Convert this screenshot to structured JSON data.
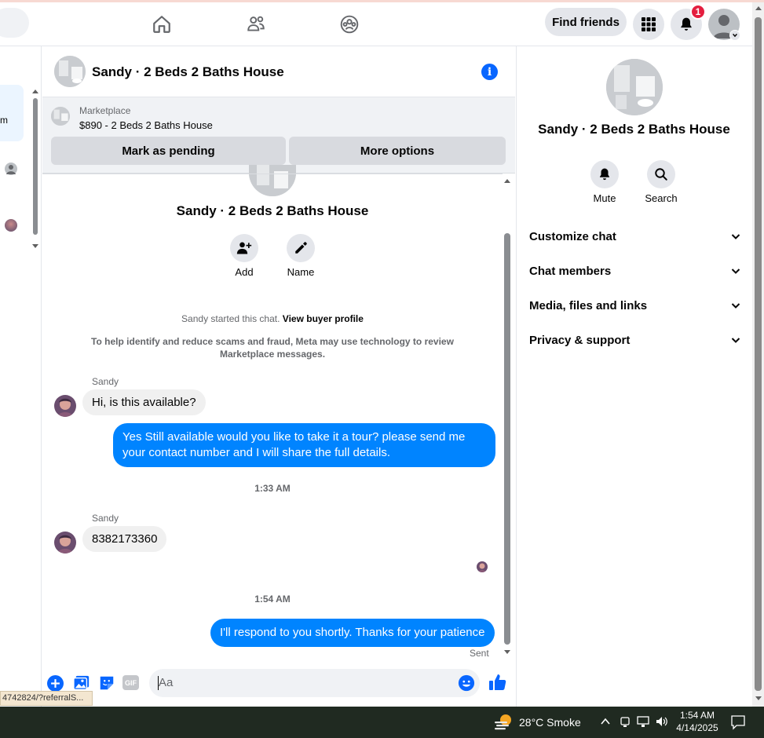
{
  "topbar": {
    "find_friends_label": "Find friends",
    "notification_count": "1"
  },
  "left_panel": {
    "selected_item_fragment": "m"
  },
  "chat_header": {
    "title": "Sandy · 2 Beds 2 Baths House"
  },
  "marketplace": {
    "label": "Marketplace",
    "listing": "$890 - 2 Beds 2 Baths House",
    "mark_pending_label": "Mark as pending",
    "more_options_label": "More options"
  },
  "chat_intro": {
    "title": "Sandy · 2 Beds 2 Baths House",
    "add_label": "Add",
    "name_label": "Name",
    "started_text": "Sandy started this chat.",
    "view_profile_link": "View buyer profile",
    "scam_notice": "To help identify and reduce scams and fraud, Meta may use technology to review Marketplace messages."
  },
  "messages": [
    {
      "type": "in",
      "sender": "Sandy",
      "text": "Hi, is this available?"
    },
    {
      "type": "out",
      "text": "Yes Still available would you like to take it a tour? please send me your contact number and I will share the full details."
    },
    {
      "type": "time",
      "text": "1:33 AM"
    },
    {
      "type": "in",
      "sender": "Sandy",
      "text": "8382173360"
    },
    {
      "type": "time",
      "text": "1:54 AM"
    },
    {
      "type": "out",
      "text": "I'll respond to you shortly. Thanks for your patience",
      "status": "Sent"
    }
  ],
  "composer": {
    "placeholder": "Aa"
  },
  "status_bar_url": "4742824/?referralS...",
  "right_panel": {
    "title": "Sandy · 2 Beds 2 Baths House",
    "mute_label": "Mute",
    "search_label": "Search",
    "sections": [
      "Customize chat",
      "Chat members",
      "Media, files and links",
      "Privacy & support"
    ]
  },
  "taskbar": {
    "weather": "28°C  Smoke",
    "time": "1:54 AM",
    "date": "4/14/2025"
  },
  "colors": {
    "accent_blue": "#0084ff",
    "icon_blue": "#0866ff",
    "badge_red": "#e41e3f",
    "taskbar": "#202a21"
  }
}
